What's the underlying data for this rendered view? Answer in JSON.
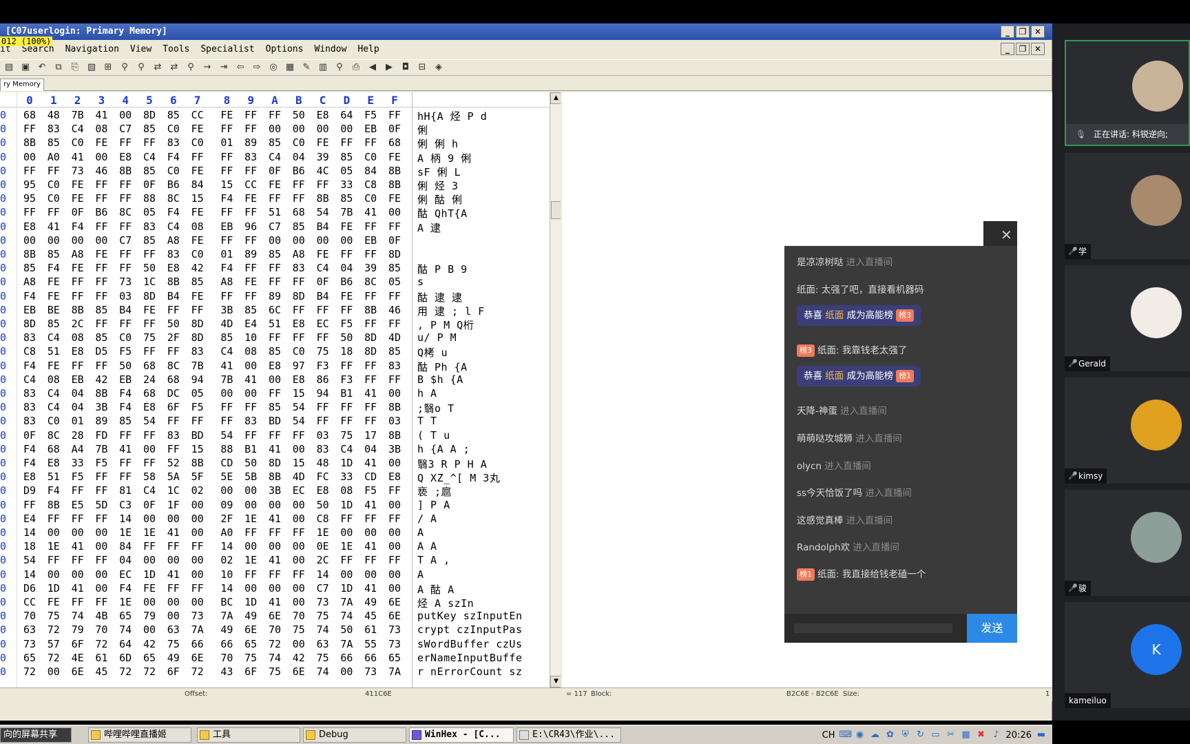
{
  "winhex": {
    "title": "[C07userlogin: Primary Memory]",
    "zoom": "012 (100%)",
    "menu": [
      "it",
      "Search",
      "Navigation",
      "View",
      "Tools",
      "Specialist",
      "Options",
      "Window",
      "Help"
    ],
    "tab": "ry Memory",
    "columns": [
      "0",
      "1",
      "2",
      "3",
      "4",
      "5",
      "6",
      "7",
      "8",
      "9",
      "A",
      "B",
      "C",
      "D",
      "E",
      "F"
    ],
    "rows": [
      {
        "b": [
          "68",
          "48",
          "7B",
          "41",
          "00",
          "8D",
          "85",
          "CC",
          "FE",
          "FF",
          "FF",
          "50",
          "E8",
          "64",
          "F5",
          "FF"
        ],
        "t": "hH{A  烃  P d"
      },
      {
        "b": [
          "FF",
          "83",
          "C4",
          "08",
          "C7",
          "85",
          "C0",
          "FE",
          "FF",
          "FF",
          "00",
          "00",
          "00",
          "00",
          "EB",
          "0F"
        ],
        "t": "   俐        "
      },
      {
        "b": [
          "8B",
          "85",
          "C0",
          "FE",
          "FF",
          "FF",
          "83",
          "C0",
          "01",
          "89",
          "85",
          "C0",
          "FE",
          "FF",
          "FF",
          "68"
        ],
        "t": "  俐    俐  h"
      },
      {
        "b": [
          "00",
          "A0",
          "41",
          "00",
          "E8",
          "C4",
          "F4",
          "FF",
          "FF",
          "83",
          "C4",
          "04",
          "39",
          "85",
          "C0",
          "FE"
        ],
        "t": " A 柄     9 俐"
      },
      {
        "b": [
          "FF",
          "FF",
          "73",
          "46",
          "8B",
          "85",
          "C0",
          "FE",
          "FF",
          "FF",
          "0F",
          "B6",
          "4C",
          "05",
          "84",
          "8B"
        ],
        "t": " sF  俐    L "
      },
      {
        "b": [
          "95",
          "C0",
          "FE",
          "FF",
          "FF",
          "0F",
          "B6",
          "84",
          "15",
          "CC",
          "FE",
          "FF",
          "FF",
          "33",
          "C8",
          "8B"
        ],
        "t": " 俐     烃  3"
      },
      {
        "b": [
          "95",
          "C0",
          "FE",
          "FF",
          "FF",
          "88",
          "8C",
          "15",
          "F4",
          "FE",
          "FF",
          "FF",
          "8B",
          "85",
          "C0",
          "FE"
        ],
        "t": " 俐    酤    俐"
      },
      {
        "b": [
          "FF",
          "FF",
          "0F",
          "B6",
          "8C",
          "05",
          "F4",
          "FE",
          "FF",
          "FF",
          "51",
          "68",
          "54",
          "7B",
          "41",
          "00"
        ],
        "t": "   酤   QhT{A "
      },
      {
        "b": [
          "E8",
          "41",
          "F4",
          "FF",
          "FF",
          "83",
          "C4",
          "08",
          "EB",
          "96",
          "C7",
          "85",
          "B4",
          "FE",
          "FF",
          "FF"
        ],
        "t": " A        逮"
      },
      {
        "b": [
          "00",
          "00",
          "00",
          "00",
          "C7",
          "85",
          "A8",
          "FE",
          "FF",
          "FF",
          "00",
          "00",
          "00",
          "00",
          "EB",
          "0F"
        ],
        "t": "          "
      },
      {
        "b": [
          "8B",
          "85",
          "A8",
          "FE",
          "FF",
          "FF",
          "83",
          "C0",
          "01",
          "89",
          "85",
          "A8",
          "FE",
          "FF",
          "FF",
          "8D"
        ],
        "t": "          "
      },
      {
        "b": [
          "85",
          "F4",
          "FE",
          "FF",
          "FF",
          "50",
          "E8",
          "42",
          "F4",
          "FF",
          "FF",
          "83",
          "C4",
          "04",
          "39",
          "85"
        ],
        "t": " 酤  P B     9"
      },
      {
        "b": [
          "A8",
          "FE",
          "FF",
          "FF",
          "73",
          "1C",
          "8B",
          "85",
          "A8",
          "FE",
          "FF",
          "FF",
          "0F",
          "B6",
          "8C",
          "05"
        ],
        "t": "    s       "
      },
      {
        "b": [
          "F4",
          "FE",
          "FF",
          "FF",
          "03",
          "8D",
          "B4",
          "FE",
          "FF",
          "FF",
          "89",
          "8D",
          "B4",
          "FE",
          "FF",
          "FF"
        ],
        "t": "酤   逮    逮"
      },
      {
        "b": [
          "EB",
          "BE",
          "8B",
          "85",
          "B4",
          "FE",
          "FF",
          "FF",
          "3B",
          "85",
          "6C",
          "FF",
          "FF",
          "FF",
          "8B",
          "46"
        ],
        "t": "用  逮   ; l    F"
      },
      {
        "b": [
          "8D",
          "85",
          "2C",
          "FF",
          "FF",
          "FF",
          "50",
          "8D",
          "4D",
          "E4",
          "51",
          "E8",
          "EC",
          "F5",
          "FF",
          "FF"
        ],
        "t": " ,   P M Q桁"
      },
      {
        "b": [
          "83",
          "C4",
          "08",
          "85",
          "C0",
          "75",
          "2F",
          "8D",
          "85",
          "10",
          "FF",
          "FF",
          "FF",
          "50",
          "8D",
          "4D"
        ],
        "t": "   u/      P M"
      },
      {
        "b": [
          "C8",
          "51",
          "E8",
          "D5",
          "F5",
          "FF",
          "FF",
          "83",
          "C4",
          "08",
          "85",
          "C0",
          "75",
          "18",
          "8D",
          "85"
        ],
        "t": "Q栲      u  "
      },
      {
        "b": [
          "F4",
          "FE",
          "FF",
          "FF",
          "50",
          "68",
          "8C",
          "7B",
          "41",
          "00",
          "E8",
          "97",
          "F3",
          "FF",
          "FF",
          "83"
        ],
        "t": "酤  Ph {A "
      },
      {
        "b": [
          "C4",
          "08",
          "EB",
          "42",
          "EB",
          "24",
          "68",
          "94",
          "7B",
          "41",
          "00",
          "E8",
          "86",
          "F3",
          "FF",
          "FF"
        ],
        "t": "  B $h {A "
      },
      {
        "b": [
          "83",
          "C4",
          "04",
          "8B",
          "F4",
          "68",
          "DC",
          "05",
          "00",
          "00",
          "FF",
          "15",
          "94",
          "B1",
          "41",
          "00"
        ],
        "t": "   h      A "
      },
      {
        "b": [
          "83",
          "C4",
          "04",
          "3B",
          "F4",
          "E8",
          "6F",
          "F5",
          "FF",
          "FF",
          "85",
          "54",
          "FF",
          "FF",
          "FF",
          "8B"
        ],
        "t": "  ;翳o    T"
      },
      {
        "b": [
          "83",
          "C0",
          "01",
          "89",
          "85",
          "54",
          "FF",
          "FF",
          "FF",
          "83",
          "BD",
          "54",
          "FF",
          "FF",
          "FF",
          "03"
        ],
        "t": "   T     T  "
      },
      {
        "b": [
          "0F",
          "8C",
          "28",
          "FD",
          "FF",
          "FF",
          "83",
          "BD",
          "54",
          "FF",
          "FF",
          "FF",
          "03",
          "75",
          "17",
          "8B"
        ],
        "t": "  (     T   u "
      },
      {
        "b": [
          "F4",
          "68",
          "A4",
          "7B",
          "41",
          "00",
          "FF",
          "15",
          "88",
          "B1",
          "41",
          "00",
          "83",
          "C4",
          "04",
          "3B"
        ],
        "t": " h {A   A   ;"
      },
      {
        "b": [
          "F4",
          "E8",
          "33",
          "F5",
          "FF",
          "FF",
          "52",
          "8B",
          "CD",
          "50",
          "8D",
          "15",
          "48",
          "1D",
          "41",
          "00"
        ],
        "t": "翳3   R  P  H A "
      },
      {
        "b": [
          "E8",
          "51",
          "F5",
          "FF",
          "FF",
          "58",
          "5A",
          "5F",
          "5E",
          "5B",
          "8B",
          "4D",
          "FC",
          "33",
          "CD",
          "E8"
        ],
        "t": " Q   XZ_^[ M 3丸"
      },
      {
        "b": [
          "D9",
          "F4",
          "FF",
          "FF",
          "81",
          "C4",
          "1C",
          "02",
          "00",
          "00",
          "3B",
          "EC",
          "E8",
          "08",
          "F5",
          "FF"
        ],
        "t": "亵      ;扈 "
      },
      {
        "b": [
          "FF",
          "8B",
          "E5",
          "5D",
          "C3",
          "0F",
          "1F",
          "00",
          "09",
          "00",
          "00",
          "00",
          "50",
          "1D",
          "41",
          "00"
        ],
        "t": "  ]       P A "
      },
      {
        "b": [
          "E4",
          "FF",
          "FF",
          "FF",
          "14",
          "00",
          "00",
          "00",
          "2F",
          "1E",
          "41",
          "00",
          "C8",
          "FF",
          "FF",
          "FF"
        ],
        "t": "     / A "
      },
      {
        "b": [
          "14",
          "00",
          "00",
          "00",
          "1E",
          "1E",
          "41",
          "00",
          "A0",
          "FF",
          "FF",
          "FF",
          "1E",
          "00",
          "00",
          "00"
        ],
        "t": "     A    "
      },
      {
        "b": [
          "18",
          "1E",
          "41",
          "00",
          "84",
          "FF",
          "FF",
          "FF",
          "14",
          "00",
          "00",
          "00",
          "0E",
          "1E",
          "41",
          "00"
        ],
        "t": "  A        A "
      },
      {
        "b": [
          "54",
          "FF",
          "FF",
          "FF",
          "04",
          "00",
          "00",
          "00",
          "02",
          "1E",
          "41",
          "00",
          "2C",
          "FF",
          "FF",
          "FF"
        ],
        "t": "T        A ,"
      },
      {
        "b": [
          "14",
          "00",
          "00",
          "00",
          "EC",
          "1D",
          "41",
          "00",
          "10",
          "FF",
          "FF",
          "FF",
          "14",
          "00",
          "00",
          "00"
        ],
        "t": "     A     "
      },
      {
        "b": [
          "D6",
          "1D",
          "41",
          "00",
          "F4",
          "FE",
          "FF",
          "FF",
          "14",
          "00",
          "00",
          "00",
          "C7",
          "1D",
          "41",
          "00"
        ],
        "t": "  A 酤       A "
      },
      {
        "b": [
          "CC",
          "FE",
          "FF",
          "FF",
          "1E",
          "00",
          "00",
          "00",
          "BC",
          "1D",
          "41",
          "00",
          "73",
          "7A",
          "49",
          "6E"
        ],
        "t": "烃       A szIn"
      },
      {
        "b": [
          "70",
          "75",
          "74",
          "4B",
          "65",
          "79",
          "00",
          "73",
          "7A",
          "49",
          "6E",
          "70",
          "75",
          "74",
          "45",
          "6E"
        ],
        "t": "putKey szInputEn"
      },
      {
        "b": [
          "63",
          "72",
          "79",
          "70",
          "74",
          "00",
          "63",
          "7A",
          "49",
          "6E",
          "70",
          "75",
          "74",
          "50",
          "61",
          "73"
        ],
        "t": "crypt czInputPas"
      },
      {
        "b": [
          "73",
          "57",
          "6F",
          "72",
          "64",
          "42",
          "75",
          "66",
          "66",
          "65",
          "72",
          "00",
          "63",
          "7A",
          "55",
          "73"
        ],
        "t": "sWordBuffer czUs"
      },
      {
        "b": [
          "65",
          "72",
          "4E",
          "61",
          "6D",
          "65",
          "49",
          "6E",
          "70",
          "75",
          "74",
          "42",
          "75",
          "66",
          "66",
          "65"
        ],
        "t": "erNameInputBuffe"
      },
      {
        "b": [
          "72",
          "00",
          "6E",
          "45",
          "72",
          "72",
          "6F",
          "72",
          "43",
          "6F",
          "75",
          "6E",
          "74",
          "00",
          "73",
          "7A"
        ],
        "t": "r nErrorCount sz"
      }
    ],
    "status": {
      "offset_label": "Offset:",
      "offset_value": "411C6E",
      "equals": "= 117",
      "block_label": "Block:",
      "block_value": "B2C6E - B2C6E",
      "size_label": "Size:",
      "size_value": "1"
    }
  },
  "taskbar": {
    "items": [
      "向的屏幕共享",
      "哔哩哔哩直播姬",
      "工具",
      "Debug",
      "WinHex - [C...",
      "E:\\CR43\\作业\\..."
    ],
    "lang": "CH",
    "clock": "20:26"
  },
  "chat": {
    "messages": [
      {
        "user": "是凉凉树哒",
        "text": "进入直播间",
        "kind": "enter"
      },
      {
        "user": "纸面:",
        "text": "太强了吧，直接看机器码",
        "kind": "msg"
      },
      {
        "pre": "恭喜",
        "user": "纸面",
        "text": "成为高能榜",
        "badge": "榜3",
        "kind": "gift"
      },
      {
        "badge": "榜3",
        "user": "纸面:",
        "text": "我靠钱老太强了",
        "kind": "badgemsg"
      },
      {
        "pre": "恭喜",
        "user": "纸面",
        "text": "成为高能榜",
        "badge": "榜1",
        "kind": "gift"
      },
      {
        "user": "天降-神蛋",
        "text": "进入直播间",
        "kind": "enter"
      },
      {
        "user": "萌萌哒攻城狮",
        "text": "进入直播间",
        "kind": "enter"
      },
      {
        "user": "olycn",
        "text": "进入直播间",
        "kind": "enter"
      },
      {
        "user": "ss今天恰饭了吗",
        "text": "进入直播间",
        "kind": "enter"
      },
      {
        "user": "这感觉真棒",
        "text": "进入直播间",
        "kind": "enter"
      },
      {
        "user": "Randolph欢",
        "text": "进入直播间",
        "kind": "enter"
      },
      {
        "badge": "榜1",
        "user": "纸面:",
        "text": "我直接给钱老磕一个",
        "kind": "badgemsg"
      }
    ],
    "send_label": "发送",
    "close": "✕"
  },
  "participants": {
    "speaking_text": "正在讲话: 科锐逆向;",
    "people": [
      {
        "name": "",
        "color": "#c9b49a"
      },
      {
        "name": "学",
        "color": "#a88a6c"
      },
      {
        "name": "Gerald",
        "color": "#f1ece6"
      },
      {
        "name": "kimsy",
        "color": "#e0a020"
      },
      {
        "name": "骏",
        "color": "#8e9e98"
      },
      {
        "name": "kameiluo",
        "color": "#1d74e8",
        "letter": "K"
      }
    ]
  },
  "colors": {
    "hex_blue": "#1b3cc8",
    "send_blue": "#2c89e6",
    "chat_bg": "#3a3a3a"
  }
}
